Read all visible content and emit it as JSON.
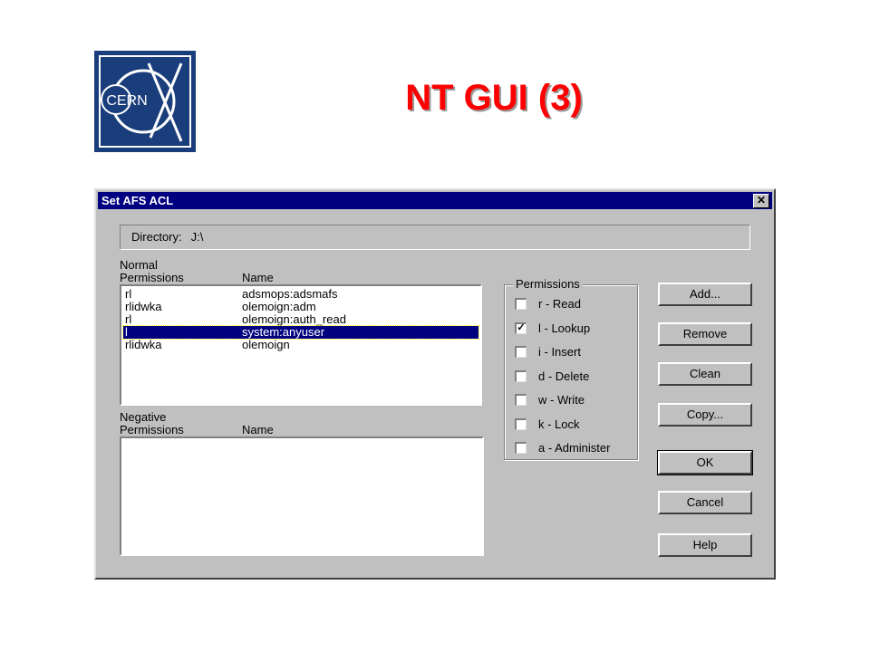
{
  "slide": {
    "title": "NT GUI (3)",
    "logo_text": "CERN"
  },
  "dialog": {
    "title": "Set AFS ACL",
    "close_glyph": "✕",
    "directory_label": "Directory:",
    "directory_value": "J:\\",
    "normal": {
      "header_line1": "Normal",
      "header_perm": "Permissions",
      "header_name": "Name",
      "rows": [
        {
          "perm": "rl",
          "name": "adsmops:adsmafs",
          "selected": false
        },
        {
          "perm": "rlidwka",
          "name": "olemoign:adm",
          "selected": false
        },
        {
          "perm": "rl",
          "name": "olemoign:auth_read",
          "selected": false
        },
        {
          "perm": "l",
          "name": "system:anyuser",
          "selected": true
        },
        {
          "perm": "rlidwka",
          "name": "olemoign",
          "selected": false
        }
      ]
    },
    "negative": {
      "header_line1": "Negative",
      "header_perm": "Permissions",
      "header_name": "Name",
      "rows": []
    },
    "permissions": {
      "group_label": "Permissions",
      "items": [
        {
          "label": "r - Read",
          "checked": false
        },
        {
          "label": "l - Lookup",
          "checked": true
        },
        {
          "label": "i - Insert",
          "checked": false
        },
        {
          "label": "d - Delete",
          "checked": false
        },
        {
          "label": "w - Write",
          "checked": false
        },
        {
          "label": "k - Lock",
          "checked": false
        },
        {
          "label": "a - Administer",
          "checked": false
        }
      ],
      "check_glyph": "✓"
    },
    "buttons": {
      "add": "Add...",
      "remove": "Remove",
      "clean": "Clean",
      "copy": "Copy...",
      "ok": "OK",
      "cancel": "Cancel",
      "help": "Help"
    }
  },
  "colors": {
    "title_red": "#ff0000",
    "titlebar": "#000080",
    "selection": "#000080",
    "dialog_bg": "#c0c0c0",
    "logo_blue": "#1a3d7c"
  }
}
